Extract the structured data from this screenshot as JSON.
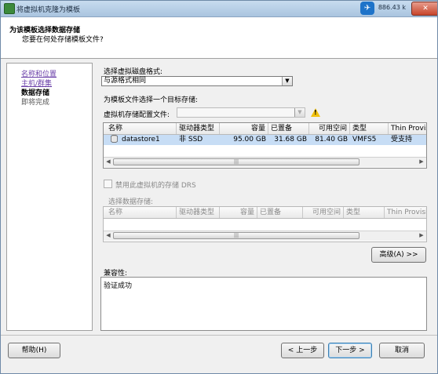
{
  "window": {
    "title": "将虚拟机克隆为模板",
    "titlebar_extra": "886.43 k",
    "close_label": "✕"
  },
  "header": {
    "title": "为该模板选择数据存储",
    "subtitle": "您要在何处存储模板文件?"
  },
  "nav": {
    "items": [
      {
        "label": "名称和位置"
      },
      {
        "label": "主机/群集"
      },
      {
        "label": "数据存储"
      },
      {
        "label": "即将完成"
      }
    ]
  },
  "disk_format": {
    "label": "选择虚拟磁盘格式:",
    "value": "与源格式相同"
  },
  "target_storage": {
    "label": "为模板文件选择一个目标存储:",
    "profile_label": "虚拟机存储配置文件:",
    "profile_value": "",
    "warning_icon": "warning-icon"
  },
  "datastore_table": {
    "columns": [
      "名称",
      "驱动器类型",
      "容量",
      "已置备",
      "可用空间",
      "类型",
      "Thin Provis"
    ],
    "rows": [
      {
        "name": "datastore1",
        "drive_type": "非 SSD",
        "capacity": "95.00 GB",
        "provisioned": "31.68 GB",
        "free": "81.40 GB",
        "type": "VMFS5",
        "thin": "受支持"
      }
    ]
  },
  "drs": {
    "label": "禁用此虚拟机的存储 DRS",
    "checked": false
  },
  "select_datastore": {
    "label": "选择数据存储:",
    "columns": [
      "名称",
      "驱动器类型",
      "容量",
      "已置备",
      "可用空间",
      "类型",
      "Thin Provisi"
    ]
  },
  "advanced_button": "高级(A) >>",
  "compatibility": {
    "label": "兼容性:",
    "value": "验证成功"
  },
  "footer": {
    "help": "帮助(H)",
    "back": "< 上一步",
    "next": "下一步 >",
    "cancel": "取消"
  },
  "colors": {
    "selected_row": "#c7ddf5",
    "link": "#6a3fa8",
    "warning": "#f2c20d"
  }
}
